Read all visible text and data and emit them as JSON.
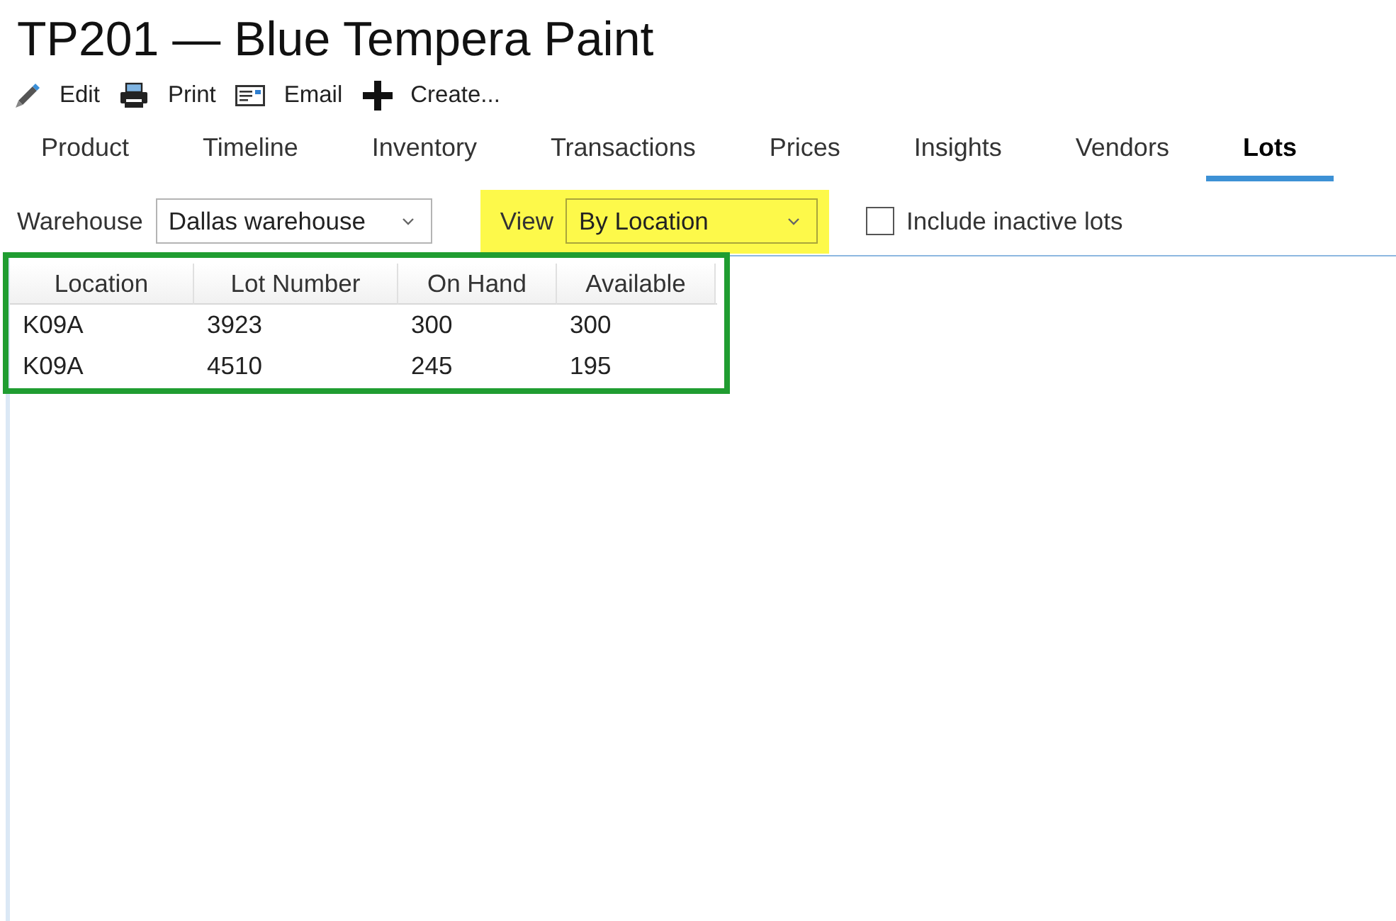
{
  "title": "TP201 — Blue Tempera Paint",
  "toolbar": [
    {
      "kind": "edit",
      "label": "Edit"
    },
    {
      "kind": "print",
      "label": "Print"
    },
    {
      "kind": "email",
      "label": "Email"
    },
    {
      "kind": "create",
      "label": "Create..."
    }
  ],
  "tabs": [
    {
      "label": "Product",
      "selected": false
    },
    {
      "label": "Timeline",
      "selected": false
    },
    {
      "label": "Inventory",
      "selected": false
    },
    {
      "label": "Transactions",
      "selected": false
    },
    {
      "label": "Prices",
      "selected": false
    },
    {
      "label": "Insights",
      "selected": false
    },
    {
      "label": "Vendors",
      "selected": false
    },
    {
      "label": "Lots",
      "selected": true
    }
  ],
  "filters": {
    "warehouse": {
      "label": "Warehouse",
      "value": "Dallas warehouse"
    },
    "view": {
      "label": "View",
      "value": "By Location",
      "highlighted": true
    },
    "include_inactive": {
      "label": "Include inactive lots",
      "checked": false
    }
  },
  "grid": {
    "outlined": true,
    "columns": [
      "Location",
      "Lot Number",
      "On Hand",
      "Available"
    ],
    "rows": [
      [
        "K09A",
        "3923",
        "300",
        "300"
      ],
      [
        "K09A",
        "4510",
        "245",
        "195"
      ]
    ]
  }
}
